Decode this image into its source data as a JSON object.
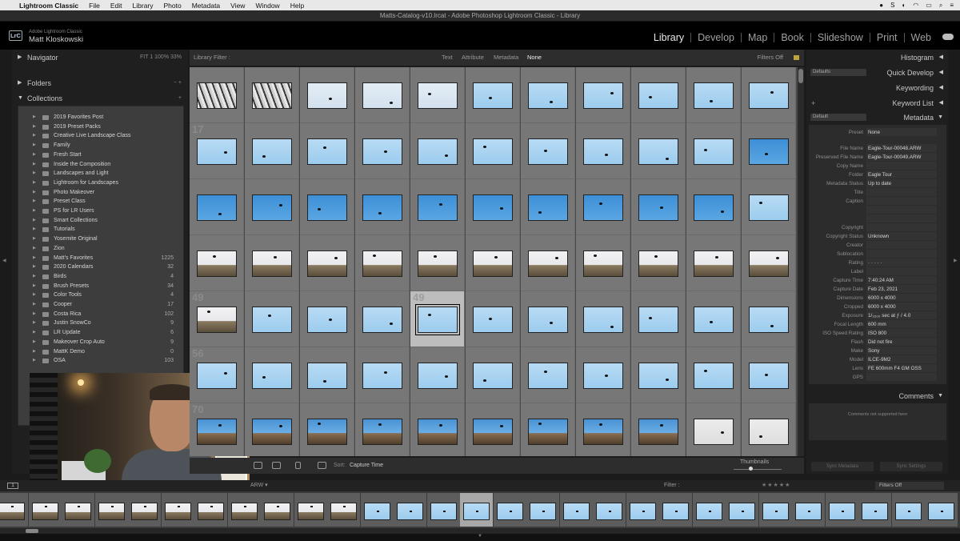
{
  "menubar": {
    "app": "Lightroom Classic",
    "items": [
      "File",
      "Edit",
      "Library",
      "Photo",
      "Metadata",
      "View",
      "Window",
      "Help"
    ]
  },
  "window_title": "Matts-Catalog-v10.lrcat - Adobe Photoshop Lightroom Classic - Library",
  "identity": {
    "badge": "LrC",
    "product": "Adobe Lightroom Classic",
    "user": "Matt Kloskowski"
  },
  "modules": {
    "library": "Library",
    "develop": "Develop",
    "map": "Map",
    "book": "Book",
    "slideshow": "Slideshow",
    "print": "Print",
    "web": "Web"
  },
  "left_panel": {
    "navigator": "Navigator",
    "navigator_zoom": "FIT  1  100%  33%",
    "folders": "Folders",
    "collections": "Collections",
    "collection_items": [
      {
        "name": "2019 Favorites Post",
        "count": ""
      },
      {
        "name": "2019 Preset Packs",
        "count": ""
      },
      {
        "name": "Creative Live Landscape Class",
        "count": ""
      },
      {
        "name": "Family",
        "count": ""
      },
      {
        "name": "Fresh Start",
        "count": ""
      },
      {
        "name": "Inside the Composition",
        "count": ""
      },
      {
        "name": "Landscapes and Light",
        "count": ""
      },
      {
        "name": "Lightroom for Landscapes",
        "count": ""
      },
      {
        "name": "Photo Makeover",
        "count": ""
      },
      {
        "name": "Preset Class",
        "count": ""
      },
      {
        "name": "PS for LR Users",
        "count": ""
      },
      {
        "name": "Smart Collections",
        "count": ""
      },
      {
        "name": "Tutorials",
        "count": ""
      },
      {
        "name": "Yosemite Original",
        "count": ""
      },
      {
        "name": "Zion",
        "count": ""
      },
      {
        "name": "Matt's Favorites",
        "count": "1225"
      },
      {
        "name": "2020 Calendars",
        "count": "32"
      },
      {
        "name": "Birds",
        "count": "4"
      },
      {
        "name": "Brush Presets",
        "count": "34"
      },
      {
        "name": "Color Tools",
        "count": "4"
      },
      {
        "name": "Cooper",
        "count": "17"
      },
      {
        "name": "Costa Rica",
        "count": "102"
      },
      {
        "name": "Justin SnowCo",
        "count": "9"
      },
      {
        "name": "LR Update",
        "count": "6"
      },
      {
        "name": "Makeover Crop Auto",
        "count": "9"
      },
      {
        "name": "MattK Demo",
        "count": "0"
      },
      {
        "name": "OSA",
        "count": "103"
      }
    ]
  },
  "filter_bar": {
    "label": "Library Filter :",
    "text": "Text",
    "attribute": "Attribute",
    "metadata": "Metadata",
    "none": "None",
    "filters_off": "Filters Off"
  },
  "grid": {
    "columns": 11,
    "row_labels": [
      "",
      "17",
      "",
      "",
      "49",
      "56",
      "70"
    ],
    "selected_index": 48,
    "rows": [
      [
        "branches",
        "branches",
        "pale",
        "pale",
        "pale",
        "sky",
        "sky",
        "sky",
        "sky",
        "sky",
        "sky"
      ],
      [
        "sky",
        "sky",
        "sky",
        "sky",
        "sky",
        "sky",
        "sky",
        "sky",
        "sky",
        "sky",
        "blue"
      ],
      [
        "blue",
        "blue",
        "blue",
        "blue",
        "blue",
        "blue",
        "blue",
        "blue",
        "blue",
        "blue",
        "sky"
      ],
      [
        "tree",
        "tree",
        "tree",
        "tree",
        "tree",
        "tree",
        "tree",
        "tree",
        "tree",
        "tree",
        "tree"
      ],
      [
        "tree",
        "sky",
        "sky",
        "sky",
        "sky",
        "sky",
        "sky",
        "sky",
        "sky",
        "sky",
        "sky"
      ],
      [
        "sky",
        "sky",
        "sky",
        "sky",
        "sky",
        "sky",
        "sky",
        "sky",
        "sky",
        "sky",
        "sky"
      ],
      [
        "tree2",
        "tree2",
        "tree2",
        "tree2",
        "tree2",
        "tree2",
        "tree2",
        "tree2",
        "tree2",
        "gray",
        "gray"
      ]
    ]
  },
  "toolbar": {
    "sort_label": "Sort:",
    "sort_value": "Capture Time",
    "thumbnails": "Thumbnails"
  },
  "right_panel": {
    "histogram": "Histogram",
    "quick_develop": "Quick Develop",
    "quick_develop_preset": "Defaults",
    "keywording": "Keywording",
    "keyword_list": "Keyword List",
    "metadata": "Metadata",
    "metadata_preset": "Default",
    "preset_label": "Preset",
    "preset_value": "None",
    "fields": [
      {
        "key": "File Name",
        "value": "Eagle-Tour-00048.ARW"
      },
      {
        "key": "Preserved File Name",
        "value": "Eagle-Tour-00049.ARW"
      },
      {
        "key": "Copy Name",
        "value": ""
      },
      {
        "key": "Folder",
        "value": "Eagle Tour"
      },
      {
        "key": "Metadata Status",
        "value": "Up to date"
      },
      {
        "key": "Title",
        "value": ""
      },
      {
        "key": "Caption",
        "value": ""
      },
      {
        "key": "",
        "value": ""
      },
      {
        "key": "",
        "value": ""
      },
      {
        "key": "Copyright",
        "value": ""
      },
      {
        "key": "Copyright Status",
        "value": "Unknown"
      },
      {
        "key": "Creator",
        "value": ""
      },
      {
        "key": "Sublocation",
        "value": ""
      },
      {
        "key": "Rating",
        "value": "· · · · ·"
      },
      {
        "key": "Label",
        "value": ""
      },
      {
        "key": "Capture Time",
        "value": "7:40:24 AM"
      },
      {
        "key": "Capture Date",
        "value": "Feb 23, 2021"
      },
      {
        "key": "Dimensions",
        "value": "6000 x 4000"
      },
      {
        "key": "Cropped",
        "value": "6000 x 4000"
      },
      {
        "key": "Exposure",
        "value": "1/₃₂₀₀ sec at ƒ / 4.0"
      },
      {
        "key": "Focal Length",
        "value": "600 mm"
      },
      {
        "key": "ISO Speed Rating",
        "value": "ISO 800"
      },
      {
        "key": "Flash",
        "value": "Did not fire"
      },
      {
        "key": "Make",
        "value": "Sony"
      },
      {
        "key": "Model",
        "value": "ILCE-9M2"
      },
      {
        "key": "Lens",
        "value": "FE 600mm F4 GM OSS"
      },
      {
        "key": "GPS",
        "value": ""
      }
    ],
    "comments": "Comments",
    "comments_note": "Comments not supported here",
    "sync_metadata": "Sync Metadata",
    "sync_settings": "Sync Settings"
  },
  "filmstrip_bar": {
    "page": "1",
    "source": "ARW ▾",
    "filter": "Filter :",
    "stars": "★★★★★",
    "filter_value": "Filters Off"
  },
  "filmstrip": {
    "count": 29,
    "selected_index": 14,
    "types": [
      "tree",
      "tree",
      "tree",
      "tree",
      "tree",
      "tree",
      "tree",
      "tree",
      "tree",
      "tree",
      "tree",
      "sky",
      "sky",
      "sky",
      "sky",
      "sky",
      "sky",
      "sky",
      "sky",
      "sky",
      "sky",
      "sky",
      "sky",
      "sky",
      "sky",
      "sky",
      "sky",
      "sky",
      "sky"
    ],
    "labels": [
      "",
      "",
      "",
      "",
      "",
      "",
      "",
      "",
      "",
      "",
      "",
      "",
      "",
      "",
      "49",
      "",
      "",
      "",
      "",
      "",
      "",
      "",
      "",
      "",
      "",
      "",
      "",
      "",
      ""
    ]
  }
}
